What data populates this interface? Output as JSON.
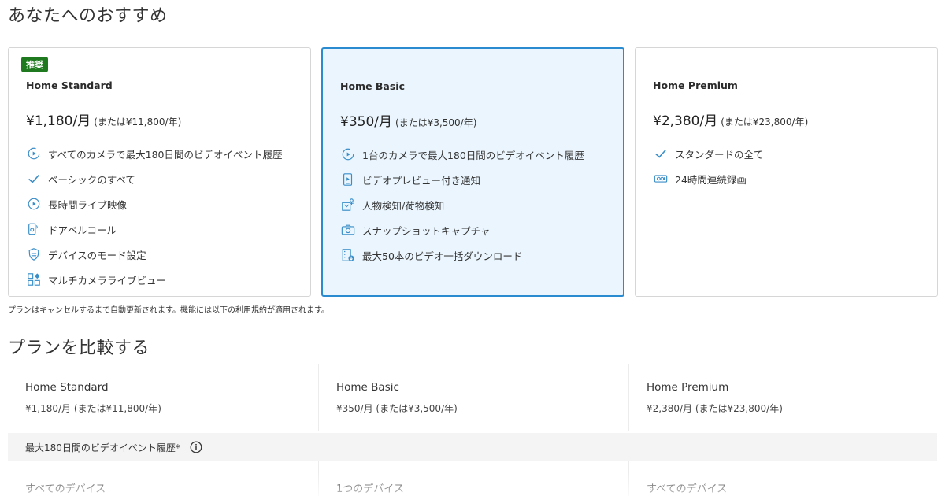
{
  "recommend": {
    "title": "あなたへのおすすめ",
    "cards": [
      {
        "badge": "推奨",
        "name": "Home Standard",
        "price": "¥1,180/月",
        "alt_price": "(または¥11,800/年)",
        "selected": false,
        "features": [
          {
            "icon": "play-history-icon",
            "text": "すべてのカメラで最大180日間のビデオイベント履歴"
          },
          {
            "icon": "check-icon",
            "text": "ベーシックのすべて"
          },
          {
            "icon": "live-play-icon",
            "text": "長時間ライブ映像"
          },
          {
            "icon": "doorbell-icon",
            "text": "ドアベルコール"
          },
          {
            "icon": "shield-mode-icon",
            "text": "デバイスのモード設定"
          },
          {
            "icon": "multi-camera-icon",
            "text": "マルチカメラライブビュー"
          }
        ]
      },
      {
        "badge": "",
        "name": "Home Basic",
        "price": "¥350/月",
        "alt_price": "(または¥3,500/年)",
        "selected": true,
        "features": [
          {
            "icon": "play-history-icon",
            "text": "1台のカメラで最大180日間のビデオイベント履歴"
          },
          {
            "icon": "preview-notification-icon",
            "text": "ビデオプレビュー付き通知"
          },
          {
            "icon": "person-package-icon",
            "text": "人物検知/荷物検知"
          },
          {
            "icon": "snapshot-camera-icon",
            "text": "スナップショットキャプチャ"
          },
          {
            "icon": "bulk-download-icon",
            "text": "最大50本のビデオ一括ダウンロード"
          }
        ]
      },
      {
        "badge": "",
        "name": "Home Premium",
        "price": "¥2,380/月",
        "alt_price": "(または¥23,800/年)",
        "selected": false,
        "features": [
          {
            "icon": "check-icon",
            "text": "スタンダードの全て"
          },
          {
            "icon": "continuous-record-icon",
            "text": "24時間連続録画"
          }
        ]
      }
    ]
  },
  "notice": "プランはキャンセルするまで自動更新されます。機能には以下の利用規約が適用されます。",
  "compare": {
    "title": "プランを比較する",
    "plans": [
      {
        "name": "Home Standard",
        "price": "¥1,180/月 (または¥11,800/年)"
      },
      {
        "name": "Home Basic",
        "price": "¥350/月 (または¥3,500/年)"
      },
      {
        "name": "Home Premium",
        "price": "¥2,380/月 (または¥23,800/年)"
      }
    ],
    "feature_row_label": "最大180日間のビデオイベント履歴*",
    "devices": [
      "すべてのデバイス",
      "1つのデバイス",
      "すべてのデバイス"
    ]
  },
  "colors": {
    "accent_blue": "#2a8bd0",
    "selected_bg": "#eaf5fd",
    "badge_green": "#1f7a1f"
  }
}
